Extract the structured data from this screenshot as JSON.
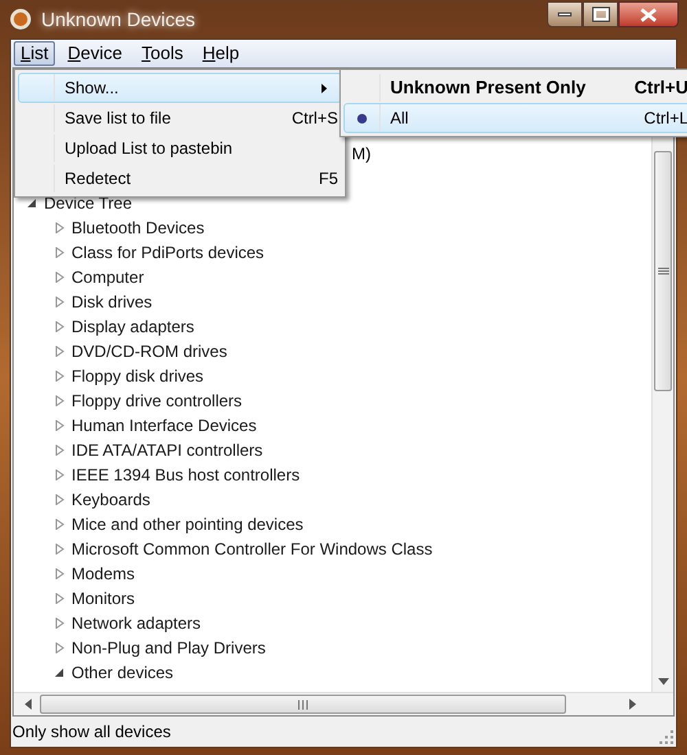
{
  "window": {
    "title": "Unknown Devices"
  },
  "menu_bar": [
    {
      "label": "List",
      "selected": true
    },
    {
      "label": "Device",
      "selected": false
    },
    {
      "label": "Tools",
      "selected": false
    },
    {
      "label": "Help",
      "selected": false
    }
  ],
  "list_menu": [
    {
      "label": "Show...",
      "has_submenu": true,
      "selected": true
    },
    {
      "label": "Save list to file",
      "shortcut": "Ctrl+S",
      "selected": false
    },
    {
      "label": "Upload List to pastebin",
      "selected": false
    },
    {
      "label": "Redetect",
      "shortcut": "F5",
      "selected": false
    }
  ],
  "show_submenu": [
    {
      "label": "Unknown Present Only",
      "shortcut": "Ctrl+U",
      "default": true,
      "checked": false,
      "selected": false
    },
    {
      "label": "All",
      "shortcut": "Ctrl+L",
      "default": false,
      "checked": true,
      "selected": true
    }
  ],
  "tree": {
    "partial_row": "M)",
    "items": [
      {
        "label": "Device Tree",
        "expanded": true,
        "children": [
          {
            "label": "Bluetooth Devices",
            "expanded": false
          },
          {
            "label": "Class for PdiPorts devices",
            "expanded": false
          },
          {
            "label": "Computer",
            "expanded": false
          },
          {
            "label": "Disk drives",
            "expanded": false
          },
          {
            "label": "Display adapters",
            "expanded": false
          },
          {
            "label": "DVD/CD-ROM drives",
            "expanded": false
          },
          {
            "label": "Floppy disk drives",
            "expanded": false
          },
          {
            "label": "Floppy drive controllers",
            "expanded": false
          },
          {
            "label": "Human Interface Devices",
            "expanded": false
          },
          {
            "label": "IDE ATA/ATAPI controllers",
            "expanded": false
          },
          {
            "label": "IEEE 1394 Bus host controllers",
            "expanded": false
          },
          {
            "label": "Keyboards",
            "expanded": false
          },
          {
            "label": "Mice and other pointing devices",
            "expanded": false
          },
          {
            "label": "Microsoft Common Controller For Windows Class",
            "expanded": false
          },
          {
            "label": "Modems",
            "expanded": false
          },
          {
            "label": "Monitors",
            "expanded": false
          },
          {
            "label": "Network adapters",
            "expanded": false
          },
          {
            "label": "Non-Plug and Play Drivers",
            "expanded": false
          },
          {
            "label": "Other devices",
            "expanded": true
          }
        ]
      }
    ]
  },
  "status_bar": "Only show all devices"
}
